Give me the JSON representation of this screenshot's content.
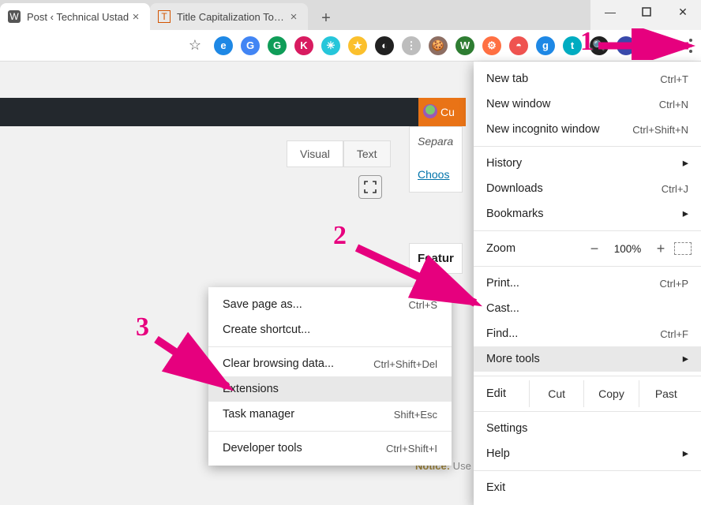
{
  "window": {
    "tabs": [
      {
        "title": "Post ‹ Technical Ustad",
        "favicon": "W"
      },
      {
        "title": "Title Capitalization Tool - Capitali",
        "favicon": "T"
      }
    ]
  },
  "extensions": [
    {
      "letter": "e",
      "bg": "#1e88e5"
    },
    {
      "letter": "G",
      "bg": "#4285f4"
    },
    {
      "letter": "G",
      "bg": "#0f9d58"
    },
    {
      "letter": "K",
      "bg": "#d81b60"
    },
    {
      "letter": "✳",
      "bg": "#26c6da"
    },
    {
      "letter": "★",
      "bg": "#fbc02d"
    },
    {
      "letter": "◐",
      "bg": "#212121"
    },
    {
      "letter": "⋮",
      "bg": "#bdbdbd"
    },
    {
      "letter": "🍪",
      "bg": "#8d6e63"
    },
    {
      "letter": "W",
      "bg": "#2e7d32"
    },
    {
      "letter": "⚙",
      "bg": "#ff7043"
    },
    {
      "letter": "◓",
      "bg": "#ef5350"
    },
    {
      "letter": "g",
      "bg": "#1e88e5"
    },
    {
      "letter": "t",
      "bg": "#00acc1"
    },
    {
      "letter": "🔍",
      "bg": "#212121"
    },
    {
      "letter": "●",
      "bg": "#3949ab"
    }
  ],
  "page": {
    "cu_label": "Cu",
    "visual": "Visual",
    "text": "Text",
    "separa": "Separa",
    "choose": "Choos",
    "featur": "Featur",
    "notice_label": "Notice:",
    "notice_text": " Use only with those post templates:"
  },
  "main_menu": {
    "new_tab": {
      "label": "New tab",
      "shortcut": "Ctrl+T"
    },
    "new_window": {
      "label": "New window",
      "shortcut": "Ctrl+N"
    },
    "incognito": {
      "label": "New incognito window",
      "shortcut": "Ctrl+Shift+N"
    },
    "history": {
      "label": "History",
      "shortcut": ""
    },
    "downloads": {
      "label": "Downloads",
      "shortcut": "Ctrl+J"
    },
    "bookmarks": {
      "label": "Bookmarks",
      "shortcut": ""
    },
    "zoom_label": "Zoom",
    "zoom_pct": "100%",
    "print": {
      "label": "Print...",
      "shortcut": "Ctrl+P"
    },
    "cast": {
      "label": "Cast...",
      "shortcut": ""
    },
    "find": {
      "label": "Find...",
      "shortcut": "Ctrl+F"
    },
    "more_tools": {
      "label": "More tools",
      "shortcut": ""
    },
    "edit_label": "Edit",
    "cut": "Cut",
    "copy": "Copy",
    "paste": "Past",
    "settings": {
      "label": "Settings"
    },
    "help": {
      "label": "Help"
    },
    "exit": {
      "label": "Exit"
    }
  },
  "submenu": {
    "save_page": {
      "label": "Save page as...",
      "shortcut": "Ctrl+S"
    },
    "shortcut": {
      "label": "Create shortcut...",
      "shortcut": ""
    },
    "clear_data": {
      "label": "Clear browsing data...",
      "shortcut": "Ctrl+Shift+Del"
    },
    "extensions": {
      "label": "Extensions",
      "shortcut": ""
    },
    "task_mgr": {
      "label": "Task manager",
      "shortcut": "Shift+Esc"
    },
    "dev_tools": {
      "label": "Developer tools",
      "shortcut": "Ctrl+Shift+I"
    }
  },
  "annotations": {
    "n1": "1",
    "n2": "2",
    "n3": "3"
  }
}
